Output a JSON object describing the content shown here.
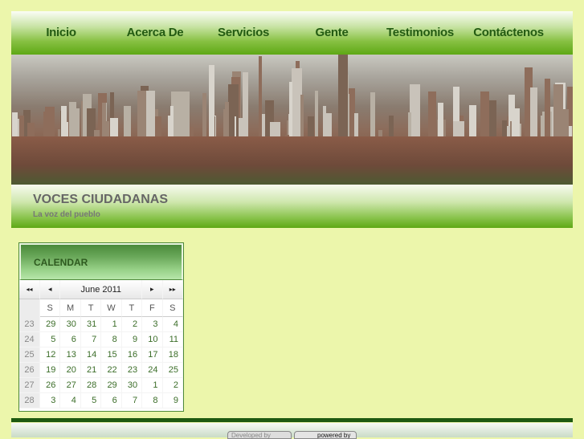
{
  "nav": [
    "Inicio",
    "Acerca De",
    "Servicios",
    "Gente",
    "Testimonios",
    "Contáctenos"
  ],
  "site": {
    "title": "VOCES CIUDADANAS",
    "subtitle": "La voz del pueblo"
  },
  "calendar": {
    "title": "CALENDAR",
    "month": "June 2011",
    "prev_year": "◂◂",
    "prev_month": "◂",
    "next_month": "▸",
    "next_year": "▸▸",
    "days": [
      "S",
      "M",
      "T",
      "W",
      "T",
      "F",
      "S"
    ],
    "weeks": [
      {
        "wk": "23",
        "d": [
          "29",
          "30",
          "31",
          "1",
          "2",
          "3",
          "4"
        ]
      },
      {
        "wk": "24",
        "d": [
          "5",
          "6",
          "7",
          "8",
          "9",
          "10",
          "11"
        ]
      },
      {
        "wk": "25",
        "d": [
          "12",
          "13",
          "14",
          "15",
          "16",
          "17",
          "18"
        ]
      },
      {
        "wk": "26",
        "d": [
          "19",
          "20",
          "21",
          "22",
          "23",
          "24",
          "25"
        ]
      },
      {
        "wk": "27",
        "d": [
          "26",
          "27",
          "28",
          "29",
          "30",
          "1",
          "2"
        ]
      },
      {
        "wk": "28",
        "d": [
          "3",
          "4",
          "5",
          "6",
          "7",
          "8",
          "9"
        ]
      }
    ]
  },
  "footer": {
    "developed": "Developed by",
    "powered": "powered by"
  }
}
